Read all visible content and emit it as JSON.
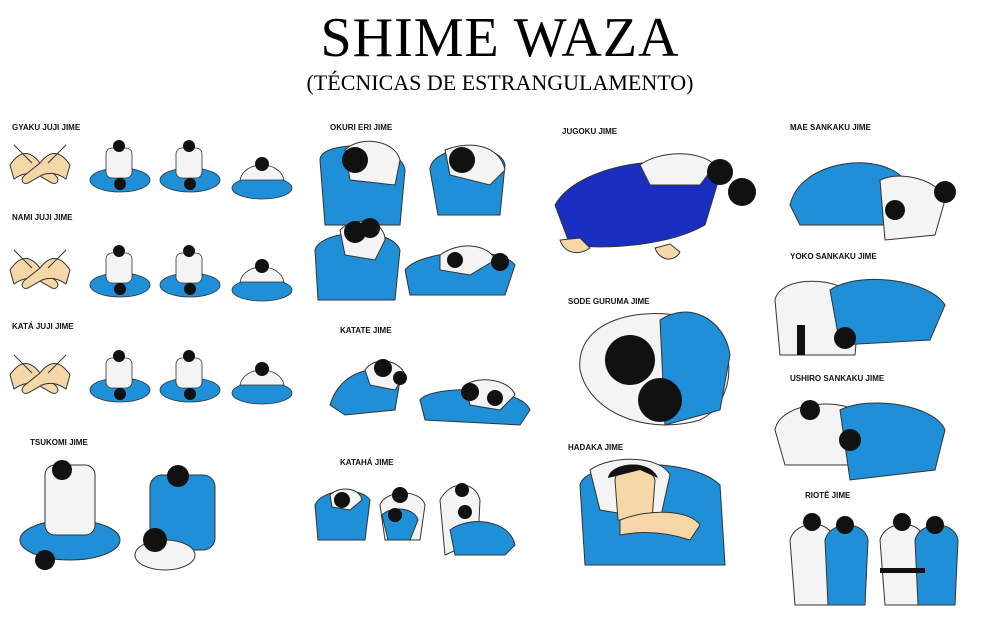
{
  "header": {
    "title": "SHIME WAZA",
    "subtitle": "(TÉCNICAS DE ESTRANGULAMENTO)"
  },
  "techniques": [
    "GYAKU JUJI JIME",
    "NAMI JUJI JIME",
    "KATÁ JUJI JIME",
    "TSUKOMI JIME",
    "OKURI ERI JIME",
    "KATATE JIME",
    "KATAHÁ JIME",
    "JUGOKU JIME",
    "SODE GURUMA JIME",
    "HADAKA JIME",
    "MAE SANKAKU JIME",
    "YOKO SANKAKU JIME",
    "USHIRO SANKAKU JIME",
    "RIOTÊ JIME"
  ],
  "colors": {
    "gi_blue": "#1f8fd8",
    "gi_dark_blue": "#1a2fc0",
    "gi_white": "#f4f4f4",
    "skin": "#f5d7a8",
    "hair": "#111111",
    "outline": "#333333"
  }
}
